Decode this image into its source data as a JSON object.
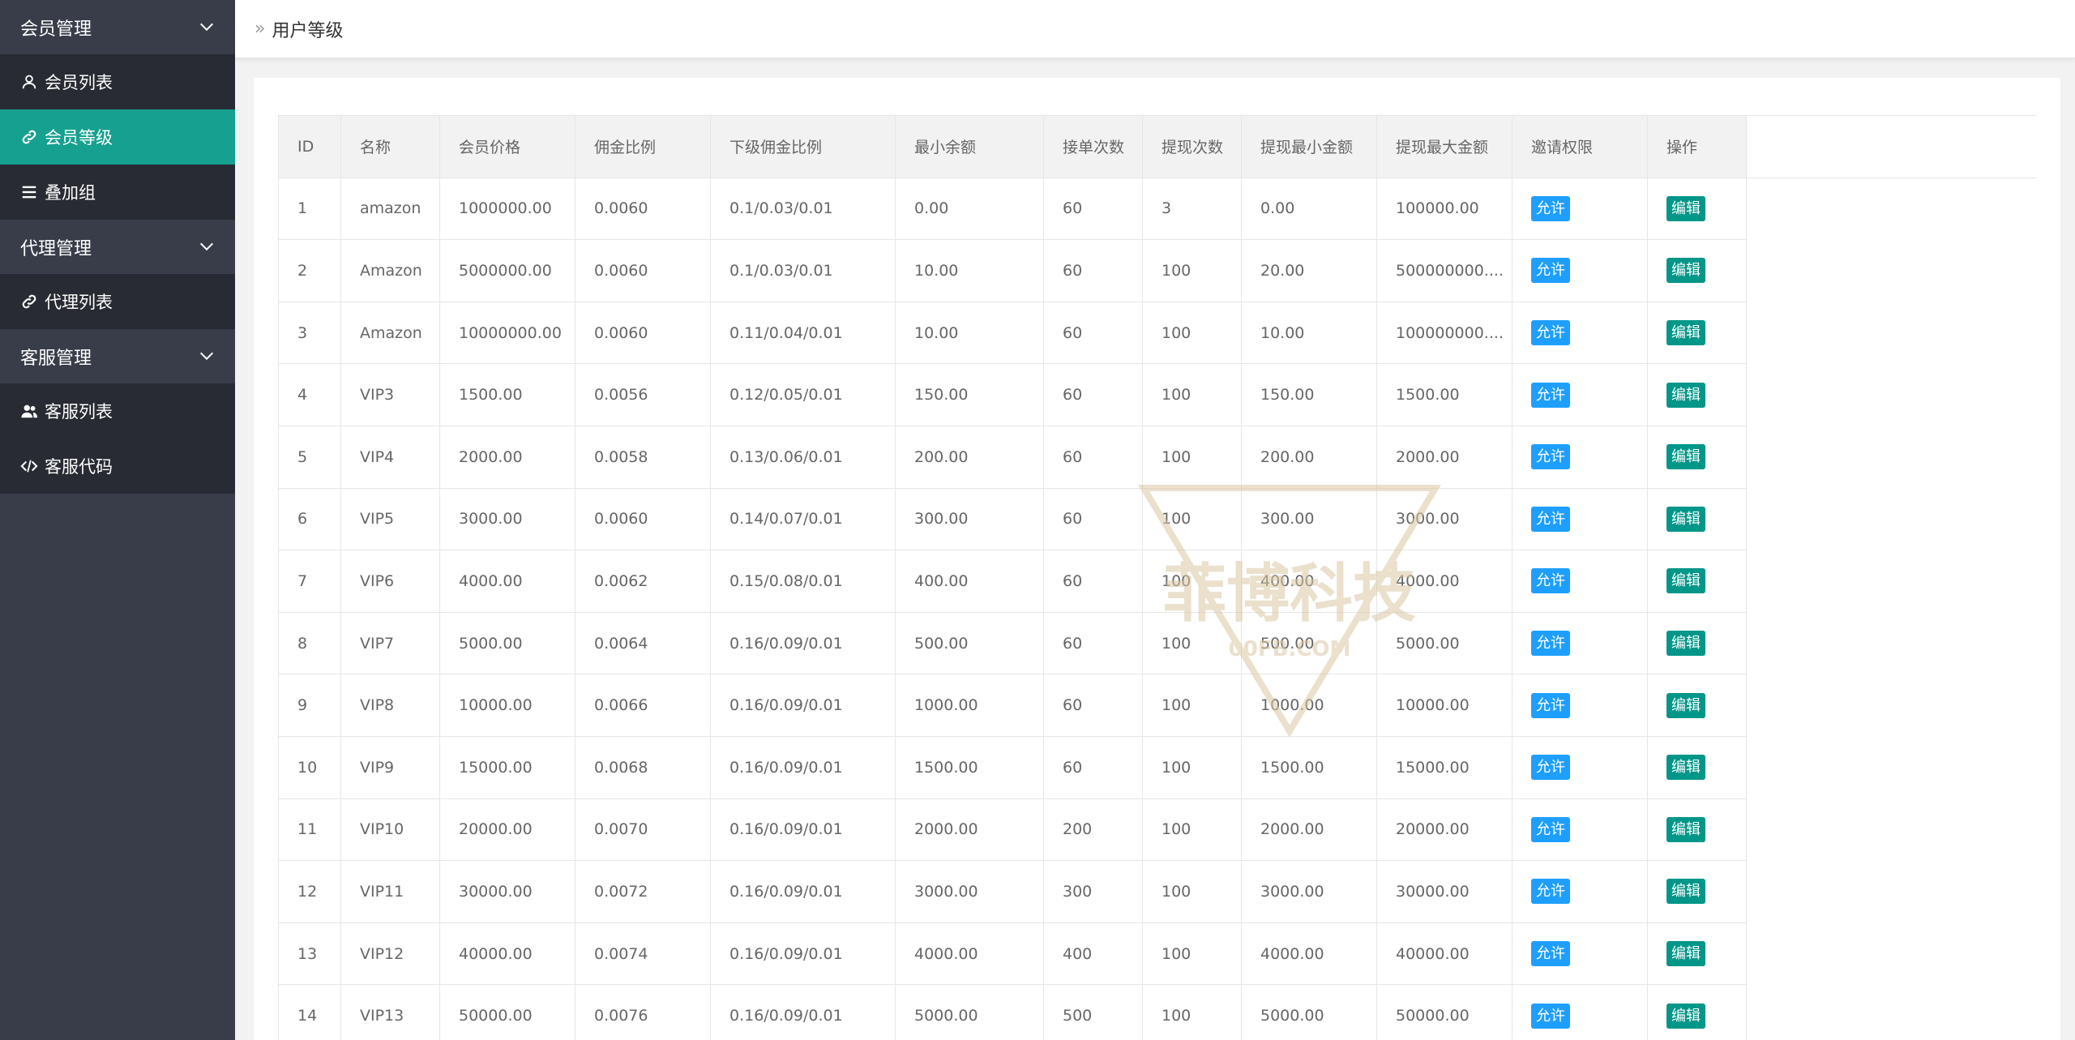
{
  "sidebar": {
    "groups": [
      {
        "label": "会员管理",
        "items": [
          {
            "label": "会员列表",
            "icon": "user-icon",
            "active": false
          },
          {
            "label": "会员等级",
            "icon": "link-icon",
            "active": true
          },
          {
            "label": "叠加组",
            "icon": "list-icon",
            "active": false
          }
        ]
      },
      {
        "label": "代理管理",
        "items": [
          {
            "label": "代理列表",
            "icon": "link-icon",
            "active": false
          }
        ]
      },
      {
        "label": "客服管理",
        "items": [
          {
            "label": "客服列表",
            "icon": "users-icon",
            "active": false
          },
          {
            "label": "客服代码",
            "icon": "code-icon",
            "active": false
          }
        ]
      }
    ]
  },
  "header": {
    "breadcrumb_icon": "double-chevron-icon",
    "breadcrumb": "用户等级"
  },
  "table": {
    "columns": [
      "ID",
      "名称",
      "会员价格",
      "佣金比例",
      "下级佣金比例",
      "最小余额",
      "接单次数",
      "提现次数",
      "提现最小金额",
      "提现最大金额",
      "邀请权限",
      "操作"
    ],
    "rows": [
      [
        "1",
        "amazon",
        "1000000.00",
        "0.0060",
        "0.1/0.03/0.01",
        "0.00",
        "60",
        "3",
        "0.00",
        "100000.00",
        "允许",
        "编辑"
      ],
      [
        "2",
        "Amazon",
        "5000000.00",
        "0.0060",
        "0.1/0.03/0.01",
        "10.00",
        "60",
        "100",
        "20.00",
        "500000000....",
        "允许",
        "编辑"
      ],
      [
        "3",
        "Amazon",
        "10000000.00",
        "0.0060",
        "0.11/0.04/0.01",
        "10.00",
        "60",
        "100",
        "10.00",
        "100000000....",
        "允许",
        "编辑"
      ],
      [
        "4",
        "VIP3",
        "1500.00",
        "0.0056",
        "0.12/0.05/0.01",
        "150.00",
        "60",
        "100",
        "150.00",
        "1500.00",
        "允许",
        "编辑"
      ],
      [
        "5",
        "VIP4",
        "2000.00",
        "0.0058",
        "0.13/0.06/0.01",
        "200.00",
        "60",
        "100",
        "200.00",
        "2000.00",
        "允许",
        "编辑"
      ],
      [
        "6",
        "VIP5",
        "3000.00",
        "0.0060",
        "0.14/0.07/0.01",
        "300.00",
        "60",
        "100",
        "300.00",
        "3000.00",
        "允许",
        "编辑"
      ],
      [
        "7",
        "VIP6",
        "4000.00",
        "0.0062",
        "0.15/0.08/0.01",
        "400.00",
        "60",
        "100",
        "400.00",
        "4000.00",
        "允许",
        "编辑"
      ],
      [
        "8",
        "VIP7",
        "5000.00",
        "0.0064",
        "0.16/0.09/0.01",
        "500.00",
        "60",
        "100",
        "500.00",
        "5000.00",
        "允许",
        "编辑"
      ],
      [
        "9",
        "VIP8",
        "10000.00",
        "0.0066",
        "0.16/0.09/0.01",
        "1000.00",
        "60",
        "100",
        "1000.00",
        "10000.00",
        "允许",
        "编辑"
      ],
      [
        "10",
        "VIP9",
        "15000.00",
        "0.0068",
        "0.16/0.09/0.01",
        "1500.00",
        "60",
        "100",
        "1500.00",
        "15000.00",
        "允许",
        "编辑"
      ],
      [
        "11",
        "VIP10",
        "20000.00",
        "0.0070",
        "0.16/0.09/0.01",
        "2000.00",
        "200",
        "100",
        "2000.00",
        "20000.00",
        "允许",
        "编辑"
      ],
      [
        "12",
        "VIP11",
        "30000.00",
        "0.0072",
        "0.16/0.09/0.01",
        "3000.00",
        "300",
        "100",
        "3000.00",
        "30000.00",
        "允许",
        "编辑"
      ],
      [
        "13",
        "VIP12",
        "40000.00",
        "0.0074",
        "0.16/0.09/0.01",
        "4000.00",
        "400",
        "100",
        "4000.00",
        "40000.00",
        "允许",
        "编辑"
      ],
      [
        "14",
        "VIP13",
        "50000.00",
        "0.0076",
        "0.16/0.09/0.01",
        "5000.00",
        "500",
        "100",
        "5000.00",
        "50000.00",
        "允许",
        "编辑"
      ]
    ]
  },
  "watermark": {
    "text": "菲博科技",
    "subtext": "00FB.COM"
  },
  "colors": {
    "sidebar_bg": "#393d49",
    "sidebar_item_bg": "#282b33",
    "active_bg": "#16a08f",
    "allow_btn": "#1e9fff",
    "edit_btn": "#009688",
    "watermark": "#d9c7a3"
  }
}
